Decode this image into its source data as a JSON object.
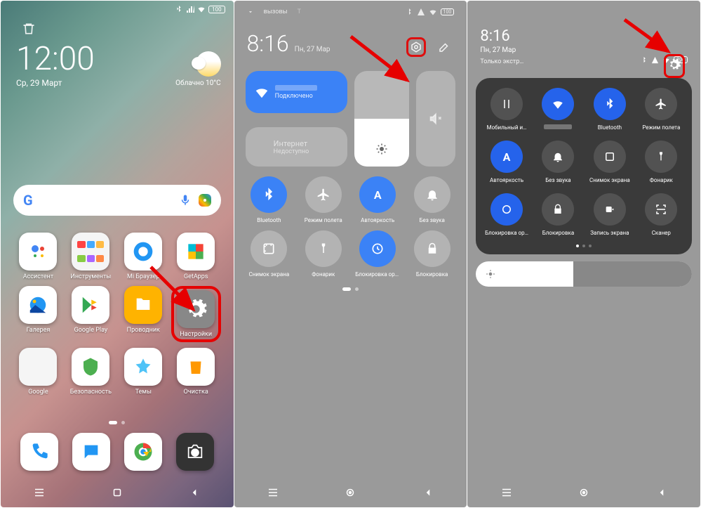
{
  "status": {
    "battery": "100",
    "battery_label": "100"
  },
  "home": {
    "time": "12:00",
    "date": "Ср, 29 Март",
    "weather": "Облачно 10°C",
    "apps_row1": [
      {
        "n": "Ассистент"
      },
      {
        "n": "Инструменты"
      },
      {
        "n": "Mi Браузер"
      },
      {
        "n": "GetApps"
      }
    ],
    "apps_row2": [
      {
        "n": "Галерея"
      },
      {
        "n": "Google Play"
      },
      {
        "n": "Проводник"
      },
      {
        "n": "Настройки"
      }
    ],
    "apps_row3": [
      {
        "n": "Google"
      },
      {
        "n": "Безопасность"
      },
      {
        "n": "Темы"
      },
      {
        "n": "Очистка"
      }
    ]
  },
  "cc": {
    "tab1": "вызовы",
    "tab2": "T",
    "time": "8:16",
    "date": "Пн, 27 Мар",
    "wifi_name": "",
    "wifi_sub": "Подключено",
    "data_name": "Интернет",
    "data_sub": "Недоступно",
    "qs": [
      {
        "n": "Bluetooth",
        "on": true
      },
      {
        "n": "Режим полета",
        "on": false
      },
      {
        "n": "Автояркость",
        "on": true
      },
      {
        "n": "Без звука",
        "on": false
      },
      {
        "n": "Снимок экрана",
        "on": false
      },
      {
        "n": "Фонарик",
        "on": false
      },
      {
        "n": "Блокировка ориент…",
        "on": true
      },
      {
        "n": "Блокировка",
        "on": false
      }
    ]
  },
  "p3": {
    "time": "8:16",
    "date": "Пн, 27 Мар",
    "sub": "Только экстр…",
    "tiles": [
      {
        "n": "Мобильный и…",
        "on": false
      },
      {
        "n": "—",
        "on": true
      },
      {
        "n": "Bluetooth",
        "on": true
      },
      {
        "n": "Режим полета",
        "on": false
      },
      {
        "n": "Автояркость",
        "on": true
      },
      {
        "n": "Без звука",
        "on": false
      },
      {
        "n": "Снимок экрана",
        "on": false
      },
      {
        "n": "Фонарик",
        "on": false
      },
      {
        "n": "Блокировка ор…",
        "on": true
      },
      {
        "n": "Блокировка",
        "on": false
      },
      {
        "n": "Запись экрана",
        "on": false
      },
      {
        "n": "Сканер",
        "on": false
      }
    ]
  }
}
